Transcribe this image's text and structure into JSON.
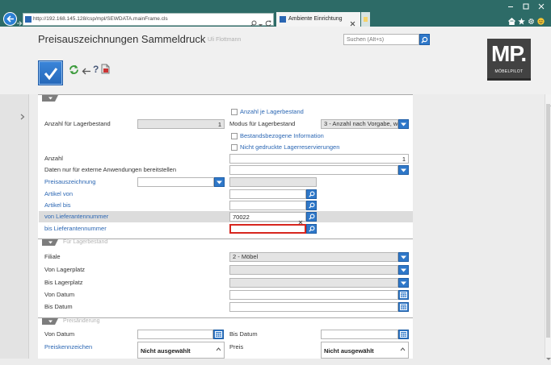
{
  "colors": {
    "accent": "#2f78c9",
    "link": "#2a66b3",
    "titlebar": "#2d6b67",
    "error": "#d7261e"
  },
  "browser": {
    "url": "http://192.168.145.128/csp/mpl/SEWDATA.mainFrame.cls",
    "tab_title": "Ambiente Einrichtung",
    "icons": [
      "back-arrow-icon",
      "forward-arrow-icon",
      "search-icon",
      "refresh-icon",
      "close-icon",
      "home-icon",
      "star-icon",
      "gear-icon",
      "smiley-icon"
    ]
  },
  "header": {
    "title": "Preisauszeichnungen Sammeldruck",
    "user": "Uli Flottmann",
    "search_placeholder": "Suchen (Alt+s)",
    "logo_text": "MP.",
    "logo_subtext": "MÖBELPILOT"
  },
  "toolbar": {
    "icons": [
      "confirm-check-icon",
      "refresh-icon",
      "back-arrow-icon",
      "help-icon",
      "document-icon"
    ]
  },
  "form": {
    "section1": {
      "anzahl_je_lagerbestand": {
        "label": "Anzahl je Lagerbestand",
        "checked": false
      },
      "anzahl_fuer_lagerbestand": {
        "label": "Anzahl für Lagerbestand",
        "value": "1"
      },
      "modus_fuer_lagerbestand": {
        "label": "Modus für Lagerbestand",
        "value": "3 - Anzahl nach Vorgabe, wen"
      },
      "bestandsbezogene_information": {
        "label": "Bestandsbezogene Information",
        "checked": false
      },
      "nicht_gedruckte_lagerreservierungen": {
        "label": "Nicht gedruckte Lagerreservierungen",
        "checked": false
      },
      "anzahl": {
        "label": "Anzahl",
        "value": "1"
      },
      "daten_extern": {
        "label": "Daten nur für externe Anwendungen bereitstellen"
      },
      "preisauszeichnung": {
        "label": "Preisauszeichnung"
      },
      "artikel_von": {
        "label": "Artikel von"
      },
      "artikel_bis": {
        "label": "Artikel bis"
      },
      "von_lieferantennummer": {
        "label": "von Lieferantennummer",
        "value": "70022"
      },
      "bis_lieferantennummer": {
        "label": "bis Lieferantennummer"
      }
    },
    "section2": {
      "title": "Für Lagerbestand",
      "filiale": {
        "label": "Filiale",
        "value": "2 - Möbel"
      },
      "von_lagerplatz": {
        "label": "Von Lagerplatz"
      },
      "bis_lagerplatz": {
        "label": "Bis Lagerplatz"
      },
      "von_datum": {
        "label": "Von Datum"
      },
      "bis_datum": {
        "label": "Bis Datum"
      }
    },
    "section3": {
      "title": "Preisänderung",
      "von_datum": {
        "label": "Von Datum"
      },
      "bis_datum": {
        "label": "Bis Datum"
      },
      "preiskennzeichen": {
        "label": "Preiskennzeichen",
        "selected": "Nicht ausgewählt"
      },
      "preis": {
        "label": "Preis",
        "selected": "Nicht ausgewählt"
      }
    }
  }
}
